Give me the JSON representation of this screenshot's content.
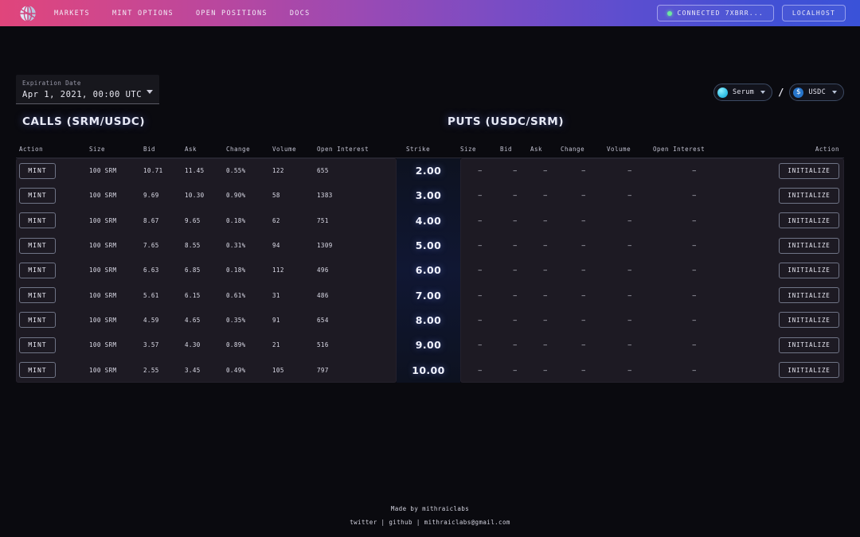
{
  "nav": {
    "logo_icon": "globe-logo-icon",
    "links": [
      {
        "label": "MARKETS"
      },
      {
        "label": "MINT OPTIONS"
      },
      {
        "label": "OPEN POSITIONS"
      },
      {
        "label": "DOCS"
      }
    ],
    "wallet": {
      "label": "CONNECTED 7XBRR...",
      "status_color": "#6ee7a0"
    },
    "network": {
      "label": "LOCALHOST"
    },
    "gradient_from": "#e0457b",
    "gradient_to": "#3a52d8"
  },
  "controls": {
    "expiration": {
      "label": "Expiration Date",
      "value": "Apr 1, 2021, 00:00 UTC"
    },
    "pair": {
      "base": {
        "name": "Serum",
        "icon": "serum-token-icon"
      },
      "separator": "/",
      "quote": {
        "name": "USDC",
        "icon": "usdc-token-icon",
        "glyph": "$"
      }
    }
  },
  "sections": {
    "calls_title": "CALLS (SRM/USDC)",
    "puts_title": "PUTS (USDC/SRM)"
  },
  "headers": {
    "calls": [
      "Action",
      "Size",
      "Bid",
      "Ask",
      "Change",
      "Volume",
      "Open Interest"
    ],
    "strike": "Strike",
    "puts": [
      "Size",
      "Bid",
      "Ask",
      "Change",
      "Volume",
      "Open Interest",
      "Action"
    ]
  },
  "labels": {
    "mint": "MINT",
    "initialize": "INITIALIZE",
    "empty": "–"
  },
  "rows": [
    {
      "strike": "2.00",
      "call": {
        "action": "MINT",
        "size": "100 SRM",
        "bid": "10.71",
        "ask": "11.45",
        "change": "0.55%",
        "volume": "122",
        "oi": "655"
      },
      "put": {
        "size": "–",
        "bid": "–",
        "ask": "–",
        "change": "–",
        "volume": "–",
        "oi": "–",
        "action": "INITIALIZE"
      }
    },
    {
      "strike": "3.00",
      "call": {
        "action": "MINT",
        "size": "100 SRM",
        "bid": "9.69",
        "ask": "10.30",
        "change": "0.90%",
        "volume": "58",
        "oi": "1383"
      },
      "put": {
        "size": "–",
        "bid": "–",
        "ask": "–",
        "change": "–",
        "volume": "–",
        "oi": "–",
        "action": "INITIALIZE"
      }
    },
    {
      "strike": "4.00",
      "call": {
        "action": "MINT",
        "size": "100 SRM",
        "bid": "8.67",
        "ask": "9.65",
        "change": "0.18%",
        "volume": "62",
        "oi": "751"
      },
      "put": {
        "size": "–",
        "bid": "–",
        "ask": "–",
        "change": "–",
        "volume": "–",
        "oi": "–",
        "action": "INITIALIZE"
      }
    },
    {
      "strike": "5.00",
      "call": {
        "action": "MINT",
        "size": "100 SRM",
        "bid": "7.65",
        "ask": "8.55",
        "change": "0.31%",
        "volume": "94",
        "oi": "1309"
      },
      "put": {
        "size": "–",
        "bid": "–",
        "ask": "–",
        "change": "–",
        "volume": "–",
        "oi": "–",
        "action": "INITIALIZE"
      }
    },
    {
      "strike": "6.00",
      "call": {
        "action": "MINT",
        "size": "100 SRM",
        "bid": "6.63",
        "ask": "6.85",
        "change": "0.18%",
        "volume": "112",
        "oi": "496"
      },
      "put": {
        "size": "–",
        "bid": "–",
        "ask": "–",
        "change": "–",
        "volume": "–",
        "oi": "–",
        "action": "INITIALIZE"
      }
    },
    {
      "strike": "7.00",
      "call": {
        "action": "MINT",
        "size": "100 SRM",
        "bid": "5.61",
        "ask": "6.15",
        "change": "0.61%",
        "volume": "31",
        "oi": "486"
      },
      "put": {
        "size": "–",
        "bid": "–",
        "ask": "–",
        "change": "–",
        "volume": "–",
        "oi": "–",
        "action": "INITIALIZE"
      }
    },
    {
      "strike": "8.00",
      "call": {
        "action": "MINT",
        "size": "100 SRM",
        "bid": "4.59",
        "ask": "4.65",
        "change": "0.35%",
        "volume": "91",
        "oi": "654"
      },
      "put": {
        "size": "–",
        "bid": "–",
        "ask": "–",
        "change": "–",
        "volume": "–",
        "oi": "–",
        "action": "INITIALIZE"
      }
    },
    {
      "strike": "9.00",
      "call": {
        "action": "MINT",
        "size": "100 SRM",
        "bid": "3.57",
        "ask": "4.30",
        "change": "0.89%",
        "volume": "21",
        "oi": "516"
      },
      "put": {
        "size": "–",
        "bid": "–",
        "ask": "–",
        "change": "–",
        "volume": "–",
        "oi": "–",
        "action": "INITIALIZE"
      }
    },
    {
      "strike": "10.00",
      "call": {
        "action": "MINT",
        "size": "100 SRM",
        "bid": "2.55",
        "ask": "3.45",
        "change": "0.49%",
        "volume": "105",
        "oi": "797"
      },
      "put": {
        "size": "–",
        "bid": "–",
        "ask": "–",
        "change": "–",
        "volume": "–",
        "oi": "–",
        "action": "INITIALIZE"
      }
    }
  ],
  "footer": {
    "made_by": "Made by mithraiclabs",
    "links": [
      "twitter",
      "github",
      "mithraiclabs@gmail.com"
    ],
    "separator": "|"
  }
}
